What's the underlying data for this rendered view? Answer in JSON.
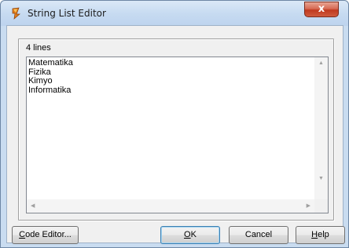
{
  "window": {
    "title": "String List Editor",
    "close_glyph": "x"
  },
  "editor": {
    "line_count": "4 lines",
    "lines": [
      "Matematika",
      "Fizika",
      "Kimyo",
      "Informatika"
    ]
  },
  "buttons": {
    "code_editor": {
      "access_key": "C",
      "rest": "ode Editor..."
    },
    "ok": {
      "access_key": "O",
      "rest": "K"
    },
    "cancel": "Cancel",
    "help": {
      "access_key": "H",
      "rest": "elp"
    }
  },
  "icons": {
    "app": "delphi-icon",
    "scroll_up": "arrow-up-icon",
    "scroll_down": "arrow-down-icon",
    "scroll_left": "arrow-left-icon",
    "scroll_right": "arrow-right-icon"
  }
}
